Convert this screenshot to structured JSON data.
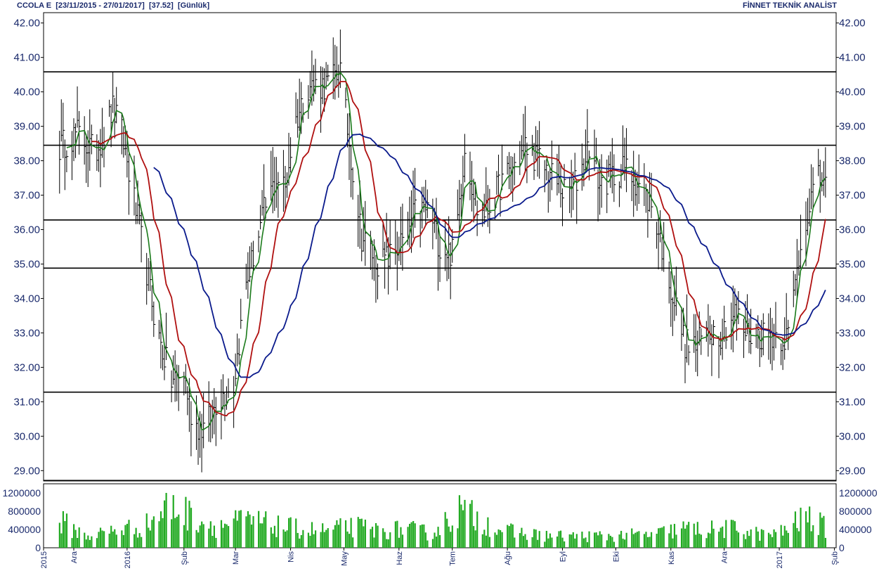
{
  "header": {
    "symbol": "CCOLA E",
    "range": "[23/11/2015 - 27/01/2017]",
    "last": "[37.52]",
    "period": "[Günlük]",
    "brand": "FİNNET TEKNİK ANALİST"
  },
  "colors": {
    "price": "#000000",
    "ma_short": "#1a7a1a",
    "ma_mid": "#b01010",
    "ma_long": "#0a1a8c",
    "volume": "#22aa22",
    "hline": "#000000",
    "axis_text": "#1a2a6c"
  },
  "chart_data": [
    {
      "type": "line",
      "title": "",
      "y_ticks": [
        "42.00",
        "41.00",
        "40.00",
        "39.00",
        "38.00",
        "37.00",
        "36.00",
        "35.00",
        "34.00",
        "33.00",
        "32.00",
        "31.00",
        "30.00",
        "29.00"
      ],
      "ylim": [
        28.7,
        42.3
      ],
      "x_ticks": [
        "2015",
        "Ara",
        "2016",
        "Şub",
        "Mar",
        "Nis",
        "May",
        "Haz",
        "Tem",
        "Ağu",
        "Eyl",
        "Eki",
        "Kas",
        "Ara",
        "2017",
        "Şub"
      ],
      "x_tick_days": [
        -9,
        8,
        38,
        70,
        99,
        130,
        160,
        191,
        221,
        252,
        283,
        313,
        344,
        374,
        405,
        436
      ],
      "x_range_days": [
        -9,
        437
      ],
      "horizontal_levels": [
        40.58,
        38.45,
        36.28,
        34.88,
        31.28,
        28.72
      ],
      "price_anchors": [
        {
          "day": 0,
          "price": 38.4
        },
        {
          "day": 10,
          "price": 38.8
        },
        {
          "day": 20,
          "price": 38.2
        },
        {
          "day": 30,
          "price": 39.5
        },
        {
          "day": 35,
          "price": 38.8
        },
        {
          "day": 45,
          "price": 36.0
        },
        {
          "day": 55,
          "price": 33.0
        },
        {
          "day": 63,
          "price": 31.6
        },
        {
          "day": 70,
          "price": 31.8
        },
        {
          "day": 75,
          "price": 30.4
        },
        {
          "day": 82,
          "price": 30.2
        },
        {
          "day": 88,
          "price": 31.0
        },
        {
          "day": 98,
          "price": 31.5
        },
        {
          "day": 105,
          "price": 34.4
        },
        {
          "day": 115,
          "price": 36.5
        },
        {
          "day": 122,
          "price": 37.5
        },
        {
          "day": 127,
          "price": 37.2
        },
        {
          "day": 132,
          "price": 39.0
        },
        {
          "day": 140,
          "price": 40.2
        },
        {
          "day": 150,
          "price": 40.2
        },
        {
          "day": 158,
          "price": 40.6
        },
        {
          "day": 163,
          "price": 38.5
        },
        {
          "day": 170,
          "price": 35.8
        },
        {
          "day": 180,
          "price": 35.0
        },
        {
          "day": 188,
          "price": 35.3
        },
        {
          "day": 195,
          "price": 35.8
        },
        {
          "day": 200,
          "price": 36.5
        },
        {
          "day": 208,
          "price": 36.6
        },
        {
          "day": 214,
          "price": 35.5
        },
        {
          "day": 222,
          "price": 35.3
        },
        {
          "day": 228,
          "price": 38.4
        },
        {
          "day": 235,
          "price": 36.6
        },
        {
          "day": 240,
          "price": 36.5
        },
        {
          "day": 248,
          "price": 37.3
        },
        {
          "day": 255,
          "price": 37.8
        },
        {
          "day": 262,
          "price": 38.4
        },
        {
          "day": 270,
          "price": 38.0
        },
        {
          "day": 278,
          "price": 37.5
        },
        {
          "day": 285,
          "price": 37.0
        },
        {
          "day": 292,
          "price": 37.5
        },
        {
          "day": 298,
          "price": 38.5
        },
        {
          "day": 304,
          "price": 37.3
        },
        {
          "day": 310,
          "price": 37.5
        },
        {
          "day": 318,
          "price": 37.8
        },
        {
          "day": 326,
          "price": 37.3
        },
        {
          "day": 334,
          "price": 36.6
        },
        {
          "day": 340,
          "price": 35.3
        },
        {
          "day": 345,
          "price": 34.1
        },
        {
          "day": 352,
          "price": 32.7
        },
        {
          "day": 358,
          "price": 32.6
        },
        {
          "day": 365,
          "price": 33.1
        },
        {
          "day": 372,
          "price": 33.0
        },
        {
          "day": 380,
          "price": 33.6
        },
        {
          "day": 386,
          "price": 33.0
        },
        {
          "day": 392,
          "price": 32.9
        },
        {
          "day": 398,
          "price": 33.0
        },
        {
          "day": 405,
          "price": 32.9
        },
        {
          "day": 410,
          "price": 32.9
        },
        {
          "day": 416,
          "price": 35.2
        },
        {
          "day": 421,
          "price": 36.6
        },
        {
          "day": 426,
          "price": 37.4
        },
        {
          "day": 431,
          "price": 37.5
        }
      ],
      "last_close": 37.52,
      "series": [
        {
          "key": "ma_short",
          "period": 5
        },
        {
          "key": "ma_mid",
          "period": 15
        },
        {
          "key": "ma_long",
          "period": 40
        }
      ]
    },
    {
      "type": "bar",
      "title": "",
      "y_ticks_left": [
        "1200000",
        "800000",
        "400000",
        "0"
      ],
      "y_ticks_right": [
        "1200000",
        "800000",
        "400000",
        "0"
      ],
      "ylim": [
        0,
        1400000
      ],
      "volume_anchors": [
        {
          "day": 0,
          "value": 600000
        },
        {
          "day": 15,
          "value": 260000
        },
        {
          "day": 35,
          "value": 420000
        },
        {
          "day": 48,
          "value": 480000
        },
        {
          "day": 62,
          "value": 950000
        },
        {
          "day": 75,
          "value": 700000
        },
        {
          "day": 88,
          "value": 480000
        },
        {
          "day": 105,
          "value": 620000
        },
        {
          "day": 120,
          "value": 500000
        },
        {
          "day": 135,
          "value": 420000
        },
        {
          "day": 150,
          "value": 380000
        },
        {
          "day": 165,
          "value": 480000
        },
        {
          "day": 180,
          "value": 380000
        },
        {
          "day": 195,
          "value": 420000
        },
        {
          "day": 210,
          "value": 320000
        },
        {
          "day": 225,
          "value": 850000
        },
        {
          "day": 235,
          "value": 650000
        },
        {
          "day": 250,
          "value": 380000
        },
        {
          "day": 265,
          "value": 300000
        },
        {
          "day": 280,
          "value": 260000
        },
        {
          "day": 300,
          "value": 260000
        },
        {
          "day": 320,
          "value": 280000
        },
        {
          "day": 335,
          "value": 300000
        },
        {
          "day": 350,
          "value": 430000
        },
        {
          "day": 365,
          "value": 400000
        },
        {
          "day": 380,
          "value": 430000
        },
        {
          "day": 395,
          "value": 300000
        },
        {
          "day": 405,
          "value": 320000
        },
        {
          "day": 420,
          "value": 700000
        },
        {
          "day": 431,
          "value": 450000
        }
      ]
    }
  ]
}
